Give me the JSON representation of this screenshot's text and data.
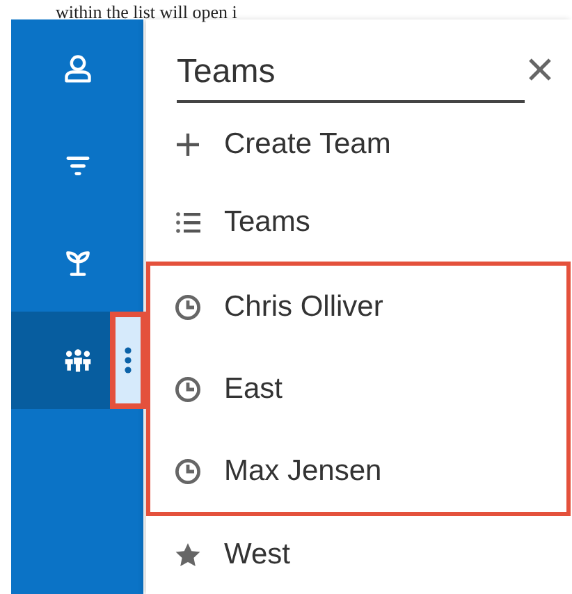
{
  "page_text": "within the list will open i",
  "sidebar": {
    "items": [
      {
        "kind": "person",
        "selected": false
      },
      {
        "kind": "filter",
        "selected": false
      },
      {
        "kind": "plant",
        "selected": false
      },
      {
        "kind": "people",
        "selected": true
      }
    ],
    "menu_button": {
      "highlighted": true
    }
  },
  "panel": {
    "search": {
      "value": "Teams"
    },
    "items": [
      {
        "kind": "create",
        "label": "Create Team",
        "highlighted": false
      },
      {
        "kind": "list",
        "label": "Teams",
        "highlighted": false
      },
      {
        "kind": "recent",
        "label": "Chris Olliver",
        "highlighted": true
      },
      {
        "kind": "recent",
        "label": "East",
        "highlighted": true
      },
      {
        "kind": "recent",
        "label": "Max Jensen",
        "highlighted": true
      },
      {
        "kind": "favorite",
        "label": "West",
        "highlighted": false
      }
    ]
  }
}
